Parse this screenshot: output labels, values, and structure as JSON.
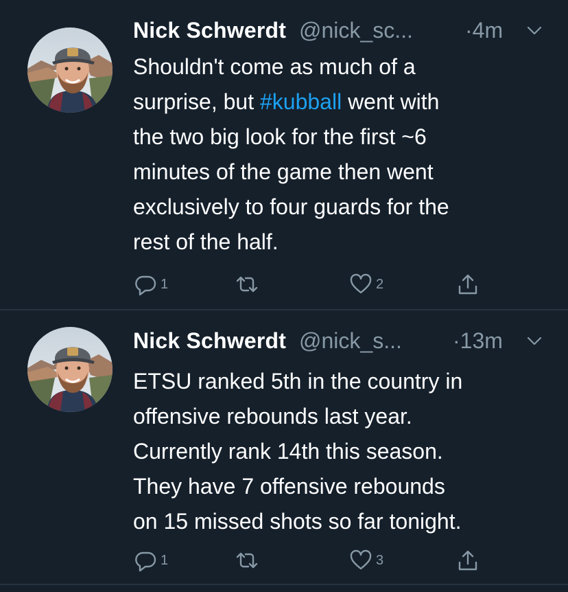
{
  "colors": {
    "background": "#15202b",
    "divider": "#26333f",
    "text_primary": "#ffffff",
    "text_secondary": "#8899a6",
    "hashtag": "#1da1f2"
  },
  "tweets": [
    {
      "name": "Nick Schwerdt",
      "handle": "@nick_sc...",
      "time": "·4m",
      "menu_icon": "chevron-down-icon",
      "body_lines": [
        "Shouldn't come as much of a",
        "surprise, but ",
        "#kubball",
        " went with",
        "the two big look for the first ~6",
        "minutes of the game then went",
        "exclusively to four guards for the",
        "rest of the half."
      ],
      "actions": {
        "reply_count": "1",
        "retweet_count": "",
        "like_count": "2",
        "share_icon": "share-icon"
      }
    },
    {
      "name": "Nick Schwerdt",
      "handle": "@nick_s...",
      "time": "·13m",
      "menu_icon": "chevron-down-icon",
      "body_lines": [
        "ETSU ranked 5th in the country in",
        "offensive rebounds last year.",
        "Currently rank 14th this season.",
        "They have 7 offensive rebounds",
        "on 15 missed shots so far tonight."
      ],
      "actions": {
        "reply_count": "1",
        "retweet_count": "",
        "like_count": "3",
        "share_icon": "share-icon"
      }
    }
  ]
}
